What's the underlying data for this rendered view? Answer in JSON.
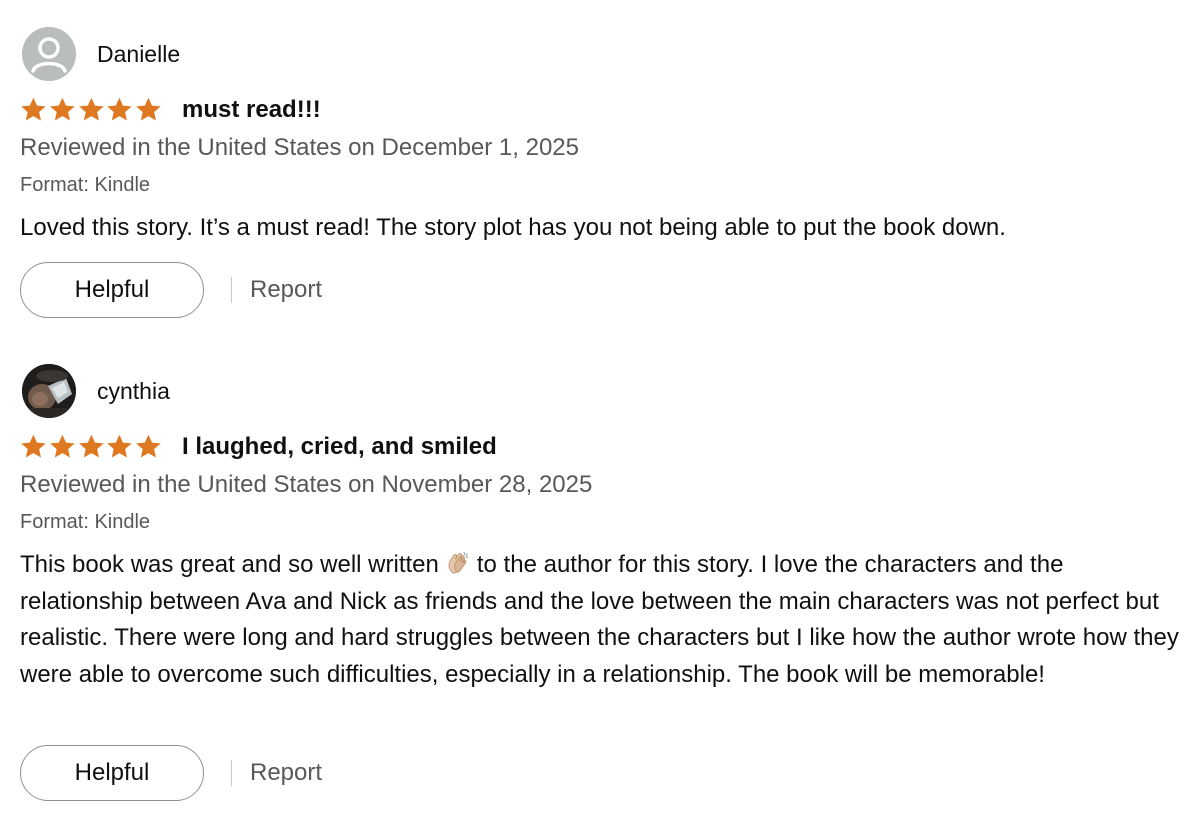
{
  "reviews": [
    {
      "reviewer": "Danielle",
      "avatar": "default-person-avatar",
      "rating": 5,
      "rating_max": 5,
      "title": "must read!!!",
      "date_line": "Reviewed in the United States on December 1, 2025",
      "format": "Format: Kindle",
      "body": [
        "Loved this story. It’s a must read! The story plot has you not being able to put the book down."
      ],
      "helpful_label": "Helpful",
      "report_label": "Report"
    },
    {
      "reviewer": "cynthia",
      "avatar": "photo-avatar",
      "rating": 5,
      "rating_max": 5,
      "title": "I laughed, cried, and smiled",
      "date_line": "Reviewed in the United States on November 28, 2025",
      "format": "Format: Kindle",
      "body_before_emoji": "This book was great and so well written",
      "body_emoji": "clapping-hands-icon",
      "body_after_emoji": "to the author for this story. I love the characters and the relationship between Ava and Nick as friends and the love between the main characters was not perfect but realistic. There were long and hard struggles between the characters but I like how the author wrote how they were able to overcome such difficulties, especially in a relationship. The book will be memorable!",
      "helpful_label": "Helpful",
      "report_label": "Report"
    }
  ],
  "colors": {
    "star": "#de7921",
    "text": "#0f1111",
    "secondary_text": "#565959",
    "button_border": "#8d9096"
  }
}
